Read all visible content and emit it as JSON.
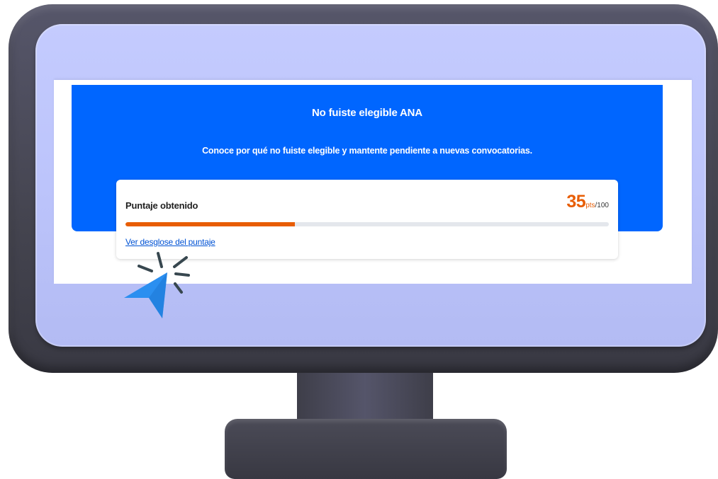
{
  "hero": {
    "title": "No fuiste elegible ANA",
    "subtitle": "Conoce por qué no fuiste elegible y mantente pendiente a nuevas convocatorias."
  },
  "score": {
    "label": "Puntaje obtenido",
    "value": "35",
    "unit": "pts",
    "max": "/100",
    "progress_fraction": 0.35,
    "link_label": "Ver desglose del puntaje"
  },
  "colors": {
    "brand_blue": "#0066ff",
    "accent_orange": "#e85d04",
    "cursor_blue": "#2b8ff0"
  },
  "icons": {
    "cursor": "click-pointer-icon"
  }
}
